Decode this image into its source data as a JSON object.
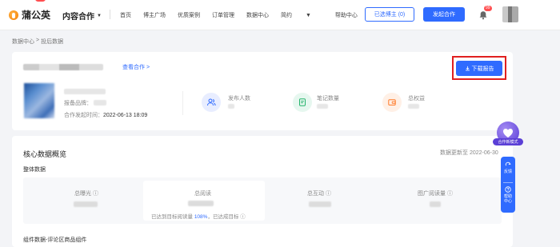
{
  "app": {
    "logo_text": "蒲公英",
    "logo_badge": "new",
    "product": "内容合作"
  },
  "nav": {
    "items": [
      "首页",
      "博主广场",
      "优质案例",
      "订单管理",
      "数据中心",
      "简约",
      "帮助中心"
    ],
    "dropdown_item": "简约"
  },
  "header_actions": {
    "selected_label": "已选博主 (0)",
    "cooperate_label": "发起合作",
    "notification_badge": "99"
  },
  "breadcrumb": {
    "parent": "数据中心",
    "separator": ">",
    "current": "投后数据"
  },
  "order": {
    "view_link": "查看合作 >",
    "download_label": "下载报告",
    "brand_label": "报备品牌：",
    "time_label": "合作发起时间：",
    "time_value": "2022-06-13 18:09"
  },
  "stats": [
    {
      "label": "发布人数",
      "icon": "users-icon",
      "color": "#e8edff",
      "icon_color": "#2f6bff"
    },
    {
      "label": "笔记数量",
      "icon": "note-icon",
      "color": "#e6f7ef",
      "icon_color": "#24b36b"
    },
    {
      "label": "总权益",
      "icon": "wallet-icon",
      "color": "#fff0e6",
      "icon_color": "#ff7a29"
    }
  ],
  "core": {
    "title": "核心数据概览",
    "update_label": "数据更新至 2022-06-30",
    "subtitle": "整体数据",
    "metrics": [
      {
        "label": "总曝光 ⓘ"
      },
      {
        "label": "总阅读"
      },
      {
        "label": "总互动 ⓘ"
      },
      {
        "label": "图广阅读量 ⓘ"
      }
    ],
    "reach_prefix": "已达到目标阅读量",
    "reach_value": "108%",
    "reach_suffix": "，已达成目标 ⓘ",
    "component_title": "组件数据-评论区商品组件"
  },
  "float": {
    "mode_label": "合作新模式",
    "feedback_label": "反馈",
    "help_label_1": "帮助",
    "help_label_2": "中心"
  },
  "colors": {
    "accent": "#2f6bff",
    "highlight": "#e02020"
  }
}
